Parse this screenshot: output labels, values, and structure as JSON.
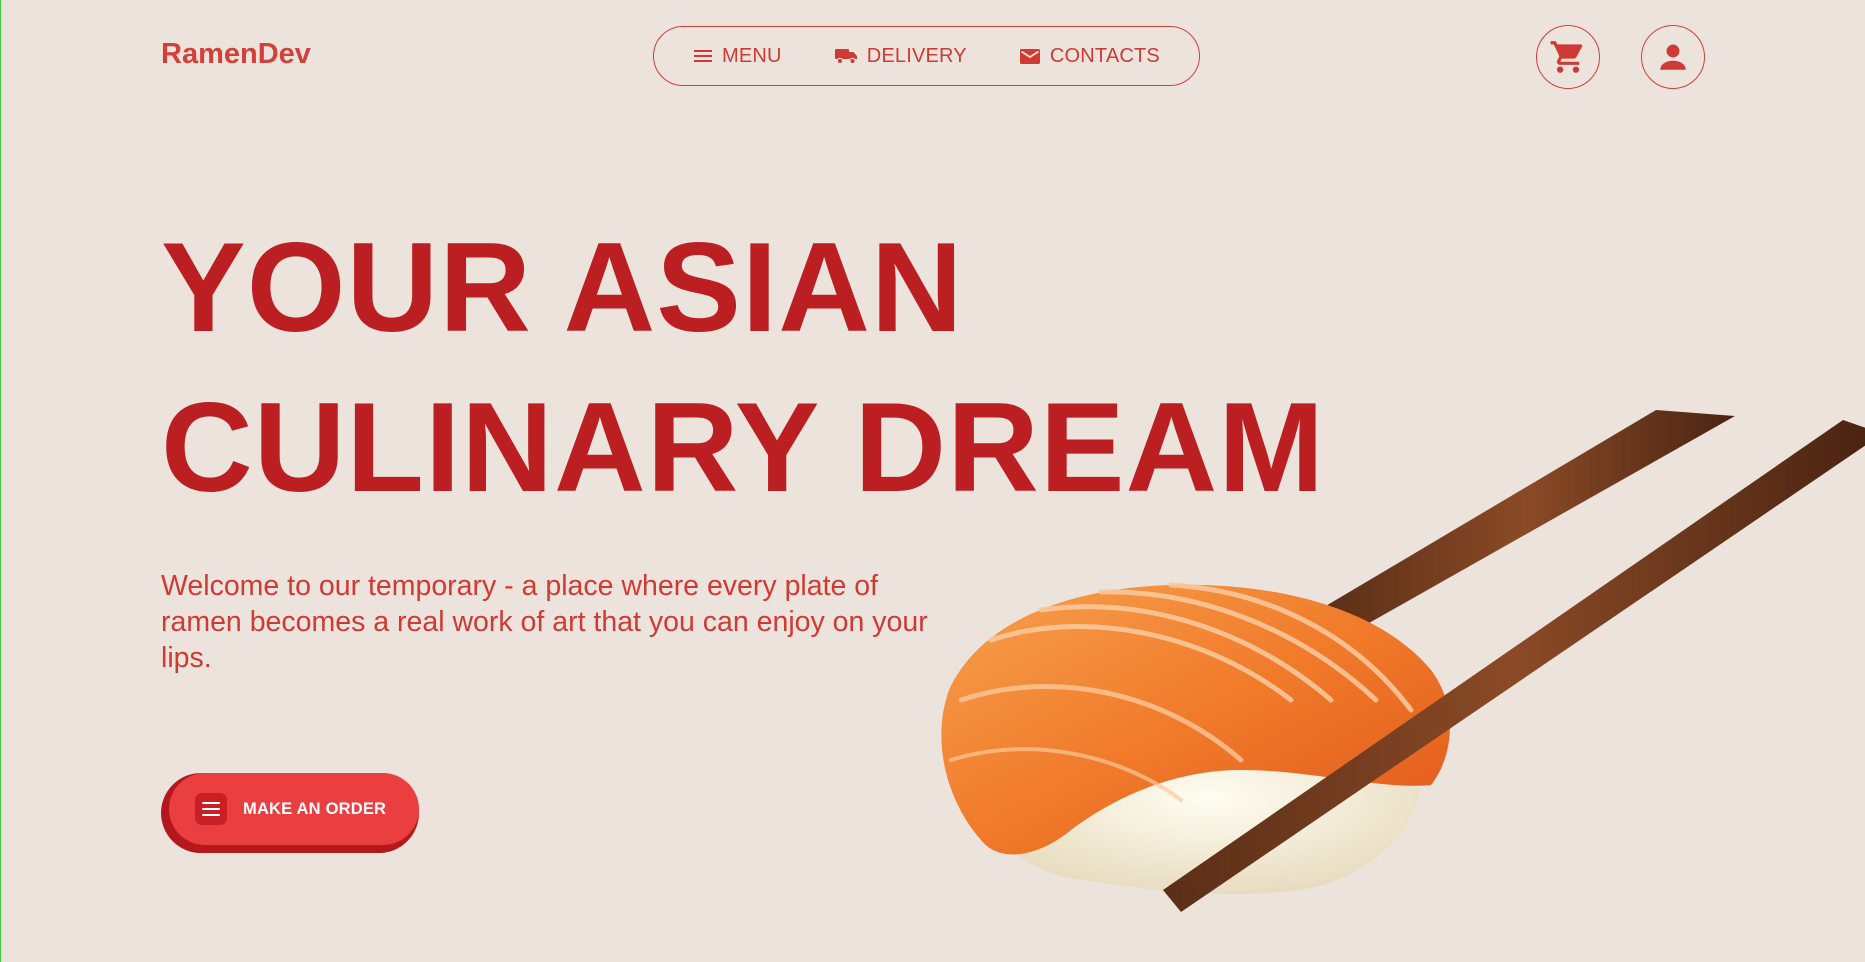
{
  "brand": {
    "name": "RamenDev",
    "accent": "#d3403a",
    "headline_color": "#bb1f22"
  },
  "nav": {
    "items": [
      {
        "label": "MENU",
        "icon": "menu-icon"
      },
      {
        "label": "DELIVERY",
        "icon": "truck-icon"
      },
      {
        "label": "CONTACTS",
        "icon": "mail-icon"
      }
    ]
  },
  "actions": {
    "cart_icon": "cart-icon",
    "profile_icon": "user-icon"
  },
  "hero": {
    "headline_line1": "YOUR ASIAN",
    "headline_line2": "CULINARY DREAM",
    "intro": "Welcome to our temporary - a place where every plate of ramen becomes a real work of art that you can enjoy on your lips.",
    "cta_label": "MAKE AN ORDER",
    "cta_icon": "list-icon",
    "image": "salmon-sushi-chopsticks"
  }
}
